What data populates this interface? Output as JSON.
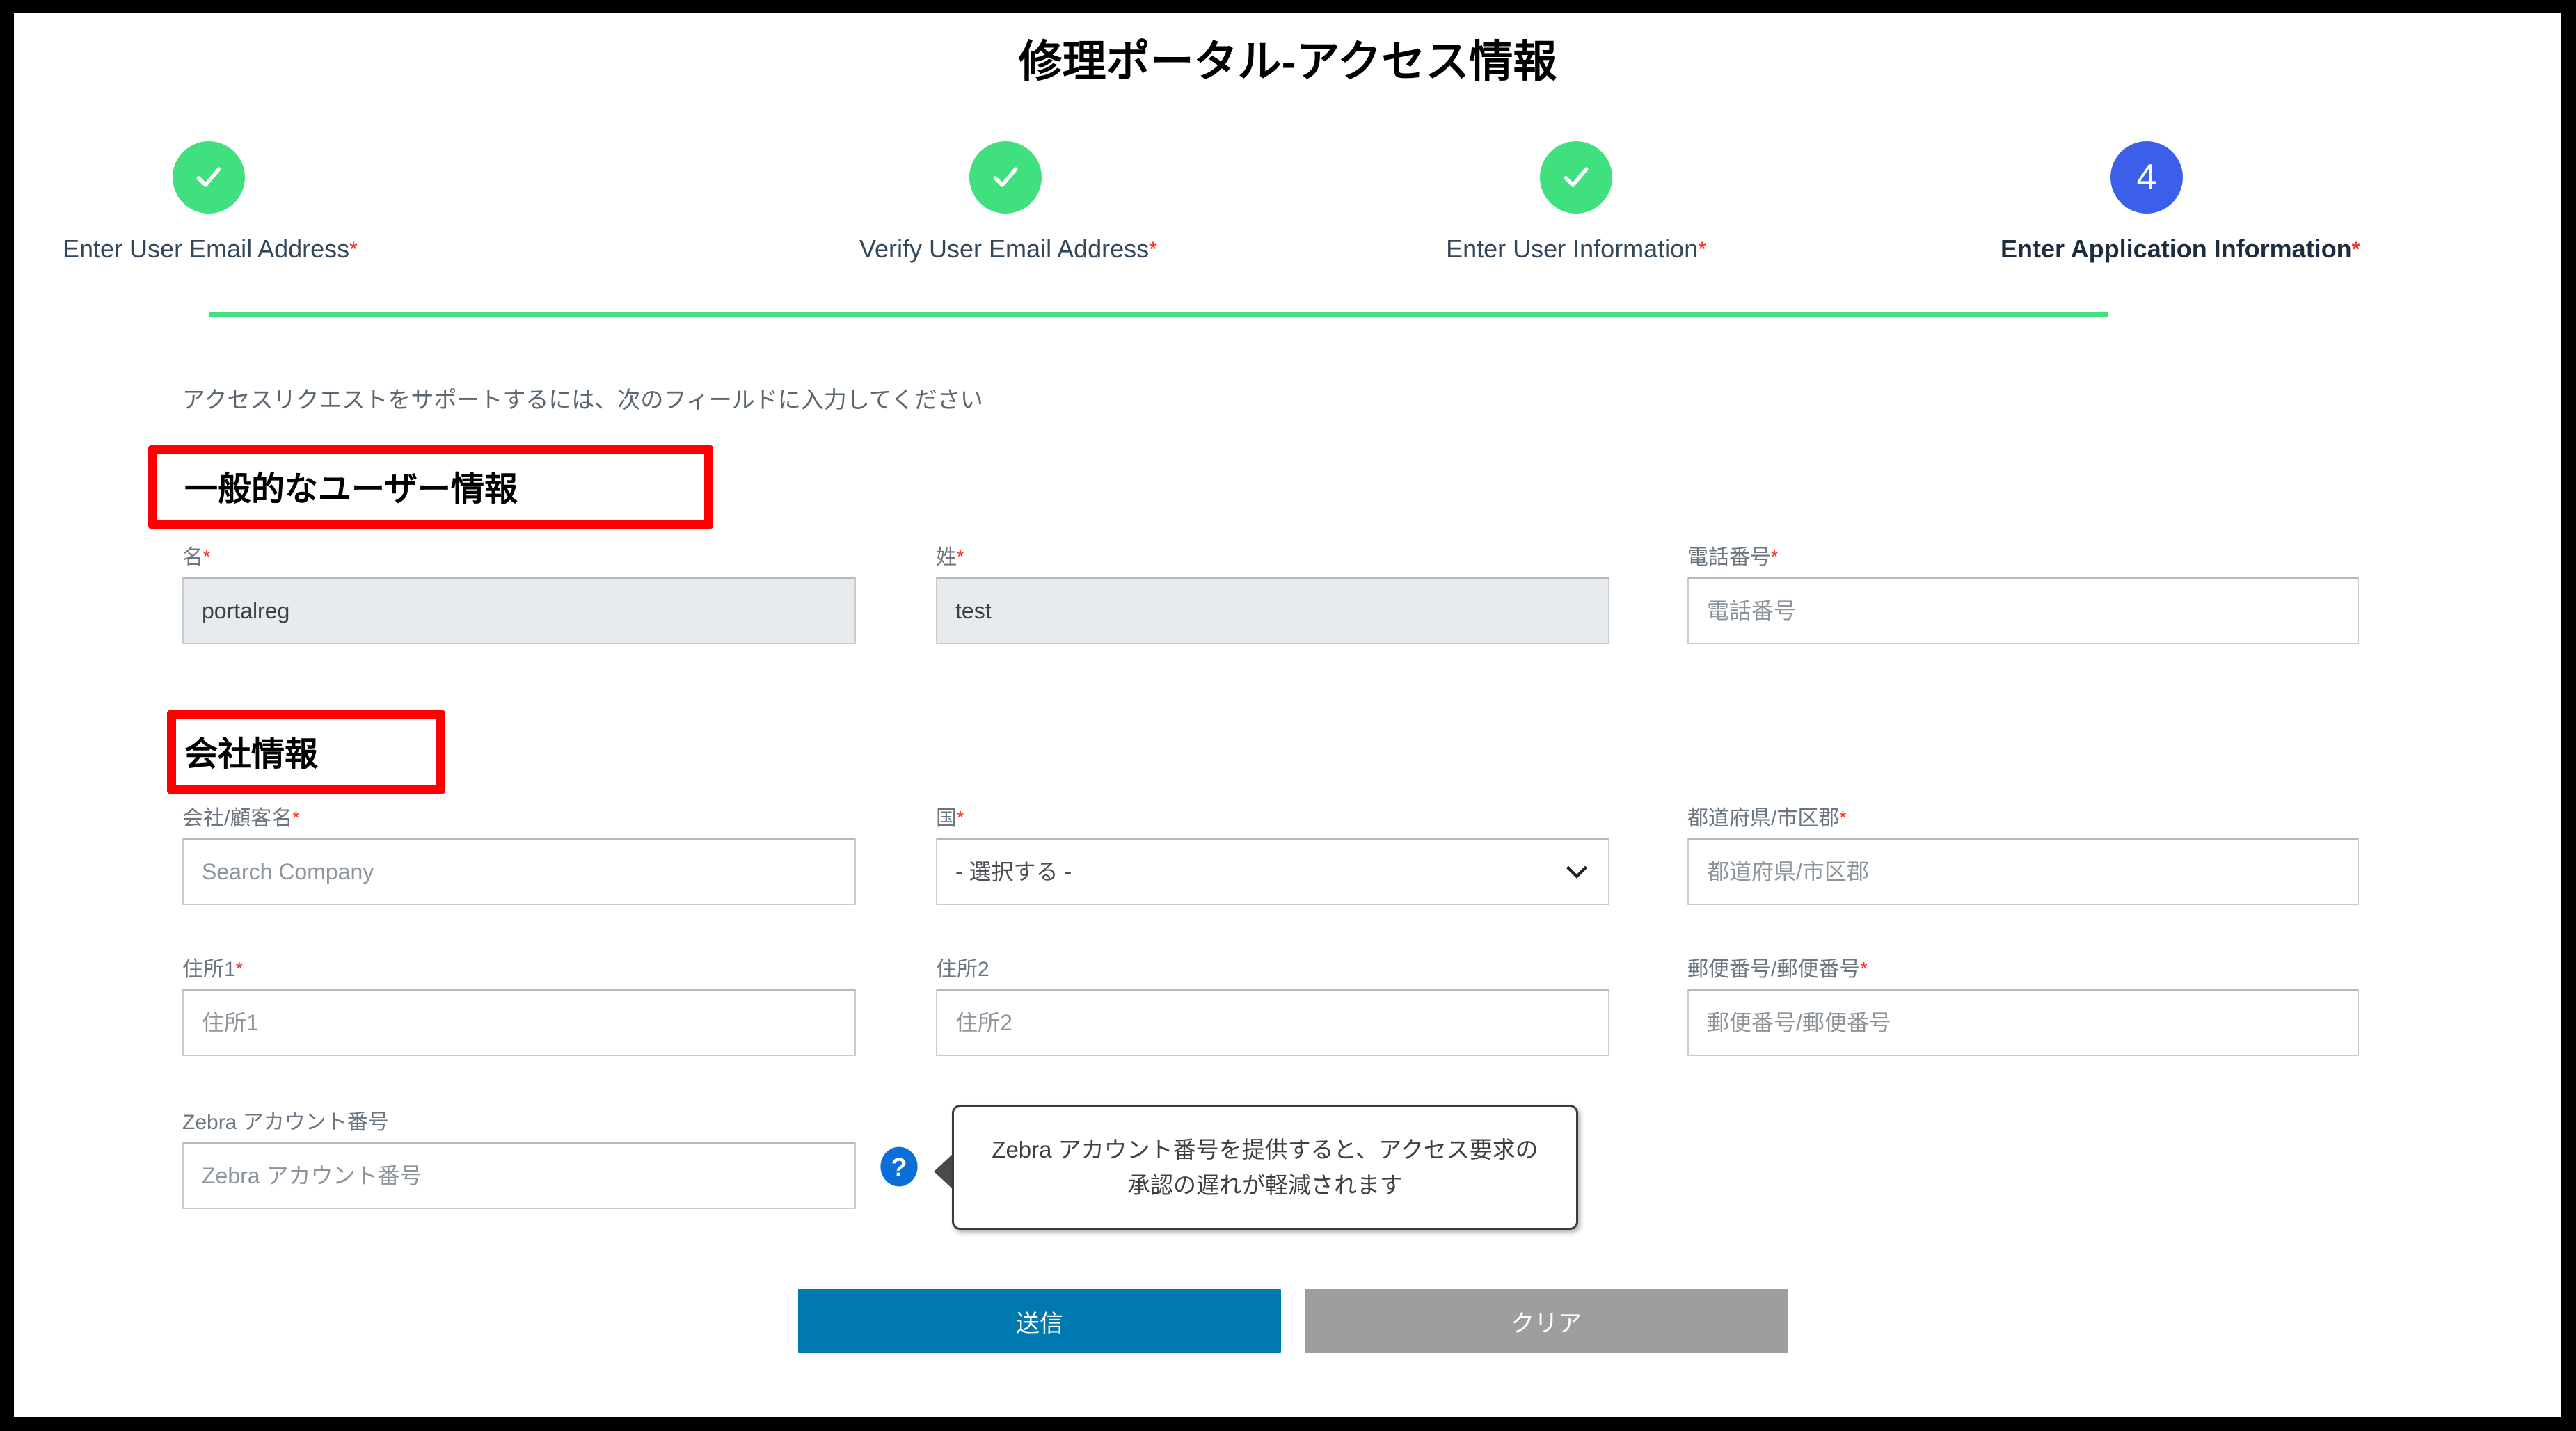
{
  "page": {
    "title": "修理ポータル-アクセス情報"
  },
  "stepper": {
    "steps": [
      {
        "state": "done",
        "marker": "check",
        "label": "Enter User Email Address",
        "required": "*"
      },
      {
        "state": "done",
        "marker": "check",
        "label": "Verify User Email Address",
        "required": "*"
      },
      {
        "state": "done",
        "marker": "check",
        "label": "Enter User Information",
        "required": "*"
      },
      {
        "state": "current",
        "marker": "4",
        "label": "Enter Application Information",
        "required": "*"
      }
    ],
    "done_color": "#3fe07d",
    "current_color": "#3b5fe8"
  },
  "form": {
    "instruction": "アクセスリクエストをサポートするには、次のフィールドに入力してください",
    "sections": [
      {
        "heading": "一般的なユーザー情報",
        "annotated": true
      },
      {
        "heading": "会社情報",
        "annotated": true
      }
    ],
    "fields": {
      "first_name": {
        "label": "名",
        "required": "*",
        "value": "portalreg",
        "placeholder": "",
        "disabled": true
      },
      "last_name": {
        "label": "姓",
        "required": "*",
        "value": "test",
        "placeholder": "",
        "disabled": true
      },
      "phone": {
        "label": "電話番号",
        "required": "*",
        "value": "",
        "placeholder": "電話番号"
      },
      "company": {
        "label": "会社/顧客名",
        "required": "*",
        "value": "",
        "placeholder": "Search Company"
      },
      "country": {
        "label": "国",
        "required": "*",
        "selected": "- 選択する -"
      },
      "state": {
        "label": "都道府県/市区郡",
        "required": "*",
        "value": "",
        "placeholder": "都道府県/市区郡"
      },
      "address1": {
        "label": "住所1",
        "required": "*",
        "value": "",
        "placeholder": "住所1"
      },
      "address2": {
        "label": "住所2",
        "required": "",
        "value": "",
        "placeholder": "住所2"
      },
      "postal": {
        "label": "郵便番号/郵便番号",
        "required": "*",
        "value": "",
        "placeholder": "郵便番号/郵便番号"
      },
      "zebra_account": {
        "label": "Zebra アカウント番号",
        "required": "",
        "value": "",
        "placeholder": "Zebra アカウント番号"
      }
    },
    "tooltip": {
      "text": "Zebra アカウント番号を提供すると、アクセス要求の承認の遅れが軽減されます",
      "icon": "question-mark-icon",
      "icon_color": "#0a6fd8"
    },
    "buttons": {
      "submit": {
        "label": "送信",
        "color": "#0079b0"
      },
      "clear": {
        "label": "クリア",
        "color": "#9e9e9e"
      }
    },
    "annotation_color": "#ff0000"
  }
}
